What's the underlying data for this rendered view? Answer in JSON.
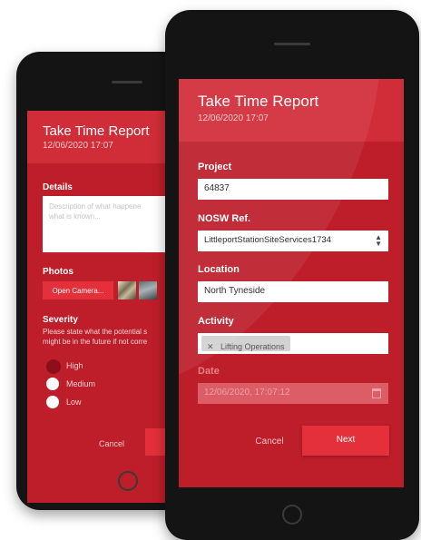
{
  "back_screen": {
    "header": {
      "title": "Take Time Report",
      "datetime": "12/06/2020 17:07"
    },
    "details": {
      "label": "Details",
      "placeholder_line1": "Description of what happene",
      "placeholder_line2": "what is known..."
    },
    "photos": {
      "label": "Photos",
      "open_camera_label": "Open Camera..."
    },
    "severity": {
      "label": "Severity",
      "help_line1": "Please state what the potential s",
      "help_line2": "might be in the future if not corre",
      "options": [
        {
          "label": "High",
          "selected": true
        },
        {
          "label": "Medium",
          "selected": false
        },
        {
          "label": "Low",
          "selected": false
        }
      ]
    },
    "buttons": {
      "cancel_label": "Cancel",
      "next_label": "N"
    }
  },
  "front_screen": {
    "header": {
      "title": "Take Time Report",
      "datetime": "12/06/2020 17:07"
    },
    "project": {
      "label": "Project",
      "value": "64837"
    },
    "nosw_ref": {
      "label": "NOSW Ref.",
      "value": "LittleportStationSiteServices1734"
    },
    "location": {
      "label": "Location",
      "value": "North Tyneside"
    },
    "activity": {
      "label": "Activity",
      "tag": "Lifting Operations"
    },
    "date": {
      "label": "Date",
      "value": "12/06/2020, 17:07:12"
    },
    "buttons": {
      "cancel_label": "Cancel",
      "next_label": "Next"
    }
  },
  "colors": {
    "screen_bg": "#bd1e2a",
    "header_bg": "#d12d38",
    "button_red": "#e3303a",
    "phone_body": "#141414"
  }
}
